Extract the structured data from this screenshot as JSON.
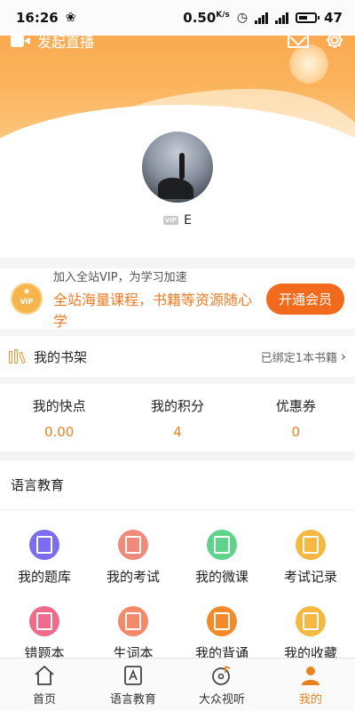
{
  "status_bar": {
    "time": "16:26",
    "speed": "0.50",
    "speed_unit": "K/s",
    "battery": "47"
  },
  "header": {
    "live_label": "发起直播",
    "icons": [
      "video-camera-icon",
      "mail-icon",
      "gear-icon"
    ]
  },
  "profile": {
    "vip_tag": "VIP",
    "username": "E"
  },
  "vip_banner": {
    "line1": "加入全站VIP，为学习加速",
    "line2": "全站海量课程，书籍等资源随心学",
    "badge_text": "VIP",
    "button": "开通会员"
  },
  "shelf": {
    "title": "我的书架",
    "status": "已绑定1本书籍",
    "chevron": "›"
  },
  "stats": [
    {
      "label": "我的快点",
      "value": "0.00"
    },
    {
      "label": "我的积分",
      "value": "4"
    },
    {
      "label": "优惠券",
      "value": "0"
    }
  ],
  "lang_section": {
    "title": "语言教育",
    "items": [
      {
        "label": "我的题库",
        "icon": "question-bank-icon",
        "color": "#7b6cf0"
      },
      {
        "label": "我的考试",
        "icon": "exam-icon",
        "color": "#f08a7a"
      },
      {
        "label": "我的微课",
        "icon": "micro-course-icon",
        "color": "#5fd38a"
      },
      {
        "label": "考试记录",
        "icon": "exam-record-icon",
        "color": "#f6b840"
      },
      {
        "label": "错题本",
        "icon": "wrong-questions-icon",
        "color": "#f06b8a"
      },
      {
        "label": "生词本",
        "icon": "vocabulary-icon",
        "color": "#f5896a"
      },
      {
        "label": "我的背诵",
        "icon": "recite-icon",
        "color": "#f58a2a"
      },
      {
        "label": "我的收藏",
        "icon": "favorites-icon",
        "color": "#f6b840"
      }
    ]
  },
  "bottom_nav": [
    {
      "label": "首页",
      "icon": "home-icon",
      "active": false
    },
    {
      "label": "语言教育",
      "icon": "language-edu-icon",
      "active": false
    },
    {
      "label": "大众视听",
      "icon": "audio-visual-icon",
      "active": false
    },
    {
      "label": "我的",
      "icon": "profile-icon",
      "active": true
    }
  ],
  "colors": {
    "accent": "#f26b1d",
    "orange_text": "#e8831f",
    "header_gradient_top": "#f9a44a"
  }
}
